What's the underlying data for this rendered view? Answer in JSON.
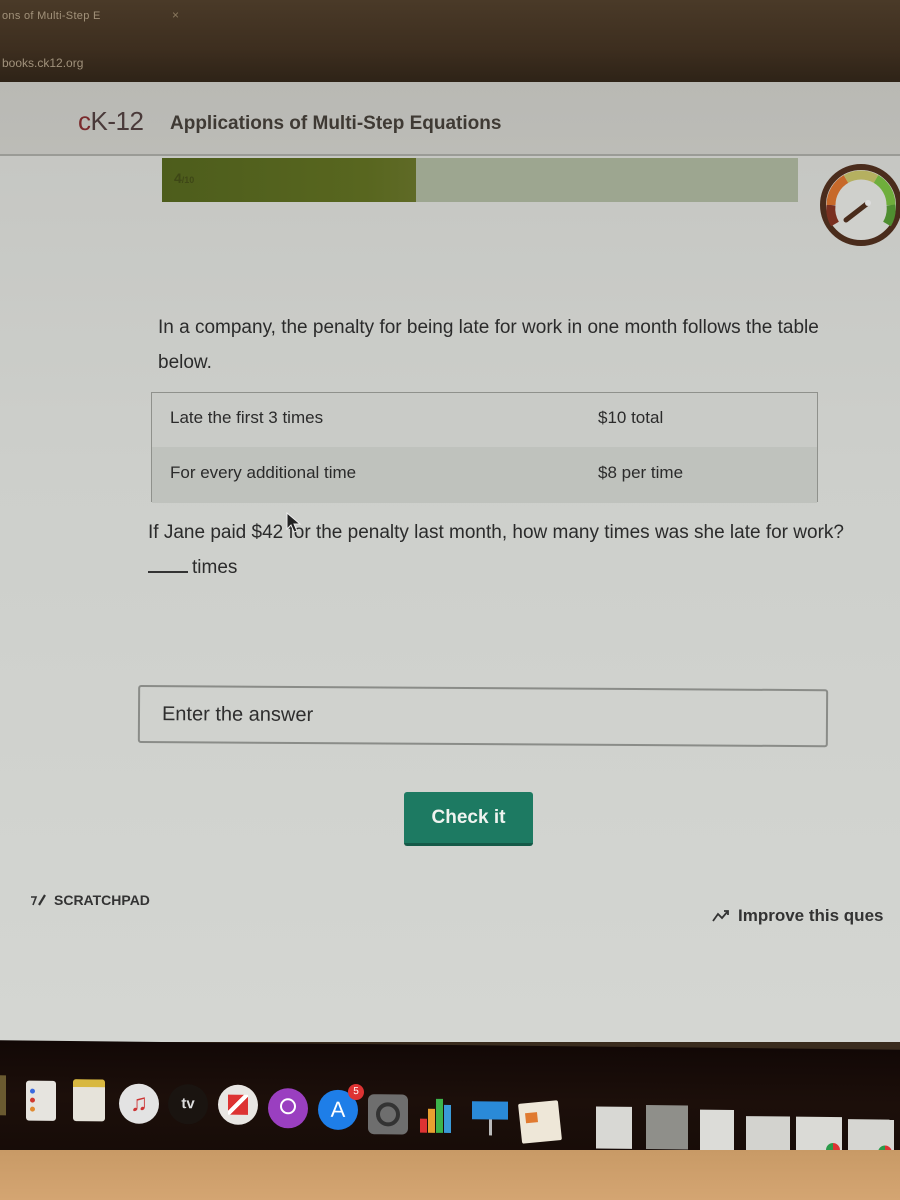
{
  "browser": {
    "tab_title": "ons of Multi-Step E",
    "tab_close": "×",
    "url": "books.ck12.org"
  },
  "header": {
    "logo": {
      "c": "c",
      "rest": "K-12"
    },
    "title": "Applications of Multi-Step Equations"
  },
  "progress": {
    "current": "4",
    "total": "/10",
    "fraction": 0.4,
    "fill_color": "#4d5d1c",
    "track_color": "#9da690"
  },
  "question": {
    "intro": "In a company, the penalty for being late for work in one month follows the table below.",
    "table": [
      {
        "condition": "Late the first 3 times",
        "penalty": "$10 total"
      },
      {
        "condition": "For every additional time",
        "penalty": "$8 per time"
      }
    ],
    "prompt": "If Jane paid $42 for the penalty last month, how many times was she late for work?",
    "unit": "times"
  },
  "answer": {
    "value": "",
    "placeholder": "Enter the answer"
  },
  "actions": {
    "check_label": "Check it",
    "check_color": "#1d7a62",
    "scratchpad_label": "SCRATCHPAD",
    "improve_label": "Improve this ques"
  },
  "dock": {
    "items": [
      {
        "name": "reminders",
        "icon": "reminders-icon"
      },
      {
        "name": "notes",
        "icon": "notes-icon"
      },
      {
        "name": "music",
        "icon": "music-icon"
      },
      {
        "name": "tv",
        "icon": "tv-icon",
        "label": "tv"
      },
      {
        "name": "news",
        "icon": "news-icon"
      },
      {
        "name": "podcasts",
        "icon": "podcasts-icon"
      },
      {
        "name": "app-store",
        "icon": "app-store-icon",
        "badge": "5"
      },
      {
        "name": "system-preferences",
        "icon": "gear-icon"
      },
      {
        "name": "numbers",
        "icon": "numbers-icon"
      },
      {
        "name": "keynote",
        "icon": "keynote-icon"
      },
      {
        "name": "pages",
        "icon": "pages-icon"
      },
      {
        "name": "document-1",
        "icon": "document-icon"
      },
      {
        "name": "document-2",
        "icon": "document-icon"
      },
      {
        "name": "document-3",
        "icon": "document-icon"
      },
      {
        "name": "document-4",
        "icon": "document-icon"
      },
      {
        "name": "chrome-document-1",
        "icon": "chrome-document-icon"
      },
      {
        "name": "chrome-document-2",
        "icon": "chrome-document-icon"
      }
    ]
  }
}
